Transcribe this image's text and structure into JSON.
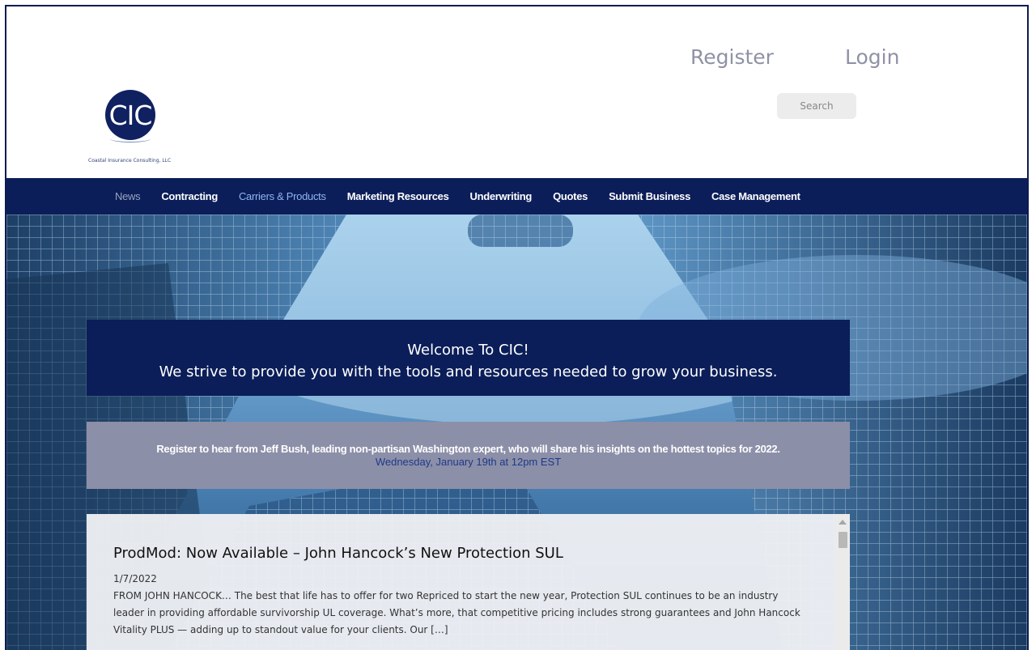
{
  "brand": {
    "logo_text": "CIC",
    "caption": "Coastal Insurance Consulting, LLC"
  },
  "header": {
    "register_label": "Register",
    "login_label": "Login",
    "search_placeholder": "Search"
  },
  "nav": {
    "items": [
      {
        "label": "News"
      },
      {
        "label": "Contracting"
      },
      {
        "label": "Carriers & Products"
      },
      {
        "label": "Marketing Resources"
      },
      {
        "label": "Underwriting"
      },
      {
        "label": "Quotes"
      },
      {
        "label": "Submit Business"
      },
      {
        "label": "Case Management"
      }
    ]
  },
  "welcome": {
    "line1": "Welcome To CIC!",
    "line2": "We strive to provide you with the tools and resources needed to grow your business."
  },
  "event": {
    "text": "Register to hear from Jeff Bush, leading non-partisan Washington expert, who will share his insights on the hottest topics for 2022.",
    "date": "Wednesday, January 19th at 12pm EST"
  },
  "news": {
    "title": "ProdMod: Now Available – John Hancock’s New Protection SUL",
    "date": "1/7/2022",
    "body": "FROM JOHN HANCOCK… The best that life has to offer for two Repriced to start the new year, Protection SUL continues to be an industry leader in providing affordable survivorship UL coverage. What’s more, that competitive pricing includes strong guarantees and John Hancock Vitality PLUS — adding up to standout value for your clients. Our […]"
  },
  "colors": {
    "navy": "#0b1e59",
    "event_bg": "#8c8fa8",
    "link_gray": "#8f92a6",
    "nav_highlight": "#8fb6f0"
  }
}
